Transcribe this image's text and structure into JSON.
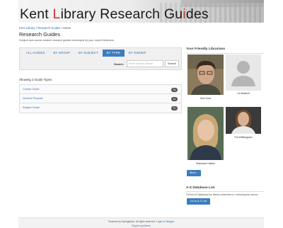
{
  "banner": {
    "title_part1": "Kent ",
    "title_L": "L",
    "title_part2": "ibrary ",
    "title_Research": "Research ",
    "title_Gu": "Gu",
    "title_i": "i",
    "title_des": "des"
  },
  "breadcrumb": {
    "items": [
      "Kent Library",
      "Research Guides",
      "Home"
    ],
    "separator": "/"
  },
  "page": {
    "title": "Research Guides",
    "subtitle": "Subject and course-related research guides developed by your expert librarians."
  },
  "tabs": [
    "ALL GUIDES",
    "BY GROUP",
    "BY SUBJECT",
    "BY TYPE",
    "BY OWNER"
  ],
  "active_tab": "BY TYPE",
  "search": {
    "label": "Search:",
    "placeholder": "Enter Search Words",
    "button": "Search"
  },
  "showing_text": "Showing 3 Guide Types",
  "guide_types": [
    {
      "label": "Course Guide",
      "count": "36"
    },
    {
      "label": "General Purpose",
      "count": "44"
    },
    {
      "label": "Subject Guide",
      "count": "70"
    }
  ],
  "sidebar": {
    "librarians_title": "Your Friendly Librarians",
    "librarians": [
      {
        "name": "Kent Gola"
      },
      {
        "name": "Liz Bedinelt"
      },
      {
        "name": "Stephanie Hallam"
      },
      {
        "name": "Pat Whittingham"
      }
    ],
    "more_button": "More...",
    "az_title": "A-Z Database List",
    "az_description": "Full list of Databases the library subscribes to, including trial access.",
    "az_button": "Go to A-Z List"
  },
  "footer": {
    "line1_prefix": "Powered by Springshare.  All rights reserved.  ",
    "line1_link": "Login to LibApps",
    "line2": "Report a problem"
  },
  "colors": {
    "accent": "#3e7cbf",
    "link": "#2a6ebb",
    "banner_red_letter": "#c0392b",
    "badge": "#555555"
  }
}
